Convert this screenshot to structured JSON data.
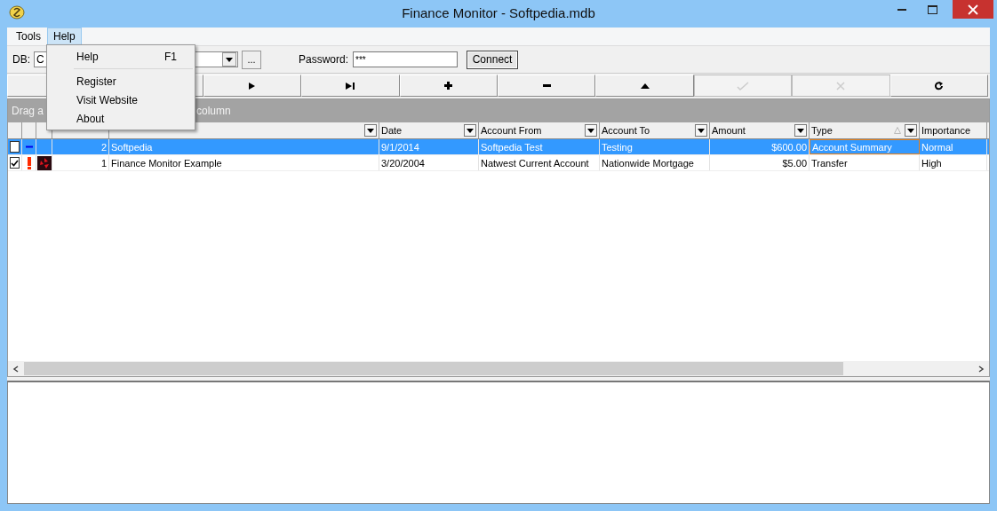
{
  "window": {
    "title": "Finance Monitor - Softpedia.mdb"
  },
  "menu_bar": [
    {
      "label": "Tools",
      "selected": false
    },
    {
      "label": "Help",
      "selected": true
    }
  ],
  "help_menu": {
    "items": [
      {
        "kind": "item",
        "label": "Help",
        "shortcut": "F1"
      },
      {
        "kind": "separator"
      },
      {
        "kind": "item",
        "label": "Register"
      },
      {
        "kind": "item",
        "label": "Visit Website"
      },
      {
        "kind": "item",
        "label": "About"
      }
    ]
  },
  "connection": {
    "db_label": "DB:",
    "db_value": "C",
    "browse_button": "...",
    "password_label": "Password:",
    "password_value": "***",
    "connect_button": "Connect"
  },
  "navigator": [
    {
      "kind": "covered",
      "disabled": false
    },
    {
      "kind": "covered",
      "disabled": false
    },
    {
      "kind": "next",
      "disabled": false
    },
    {
      "kind": "last",
      "disabled": false
    },
    {
      "kind": "insert",
      "disabled": false
    },
    {
      "kind": "delete",
      "disabled": false
    },
    {
      "kind": "edit",
      "disabled": false
    },
    {
      "kind": "post",
      "disabled": true
    },
    {
      "kind": "cancel",
      "disabled": true
    },
    {
      "kind": "refresh",
      "disabled": false
    }
  ],
  "group_panel": {
    "text_start": "Drag a",
    "text_end": "column"
  },
  "table": {
    "columns": [
      {
        "label": "Date",
        "sorted": false
      },
      {
        "label": "Account From",
        "sorted": false
      },
      {
        "label": "Account To",
        "sorted": false
      },
      {
        "label": "Amount",
        "sorted": false
      },
      {
        "label": "Type",
        "sorted": true
      },
      {
        "label": "Importance",
        "sorted": false
      }
    ],
    "rows": [
      {
        "selected": true,
        "checked": false,
        "alert": false,
        "logo": false,
        "id": "2",
        "description": "Softpedia",
        "cells": [
          {
            "text": "9/1/2014",
            "focused": false
          },
          {
            "text": "Softpedia Test",
            "focused": false
          },
          {
            "text": "Testing",
            "focused": false
          },
          {
            "text": "$600.00",
            "focused": false
          },
          {
            "text": "Account Summary",
            "focused": true
          },
          {
            "text": "Normal",
            "focused": false
          }
        ]
      },
      {
        "selected": false,
        "checked": true,
        "alert": true,
        "logo": true,
        "id": "1",
        "description": "Finance Monitor Example",
        "cells": [
          {
            "text": "3/20/2004",
            "focused": false
          },
          {
            "text": "Natwest Current Account",
            "focused": false
          },
          {
            "text": "Nationwide Mortgage",
            "focused": false
          },
          {
            "text": "$5.00",
            "focused": false
          },
          {
            "text": "Transfer",
            "focused": false
          },
          {
            "text": "High",
            "focused": false
          }
        ]
      }
    ]
  }
}
